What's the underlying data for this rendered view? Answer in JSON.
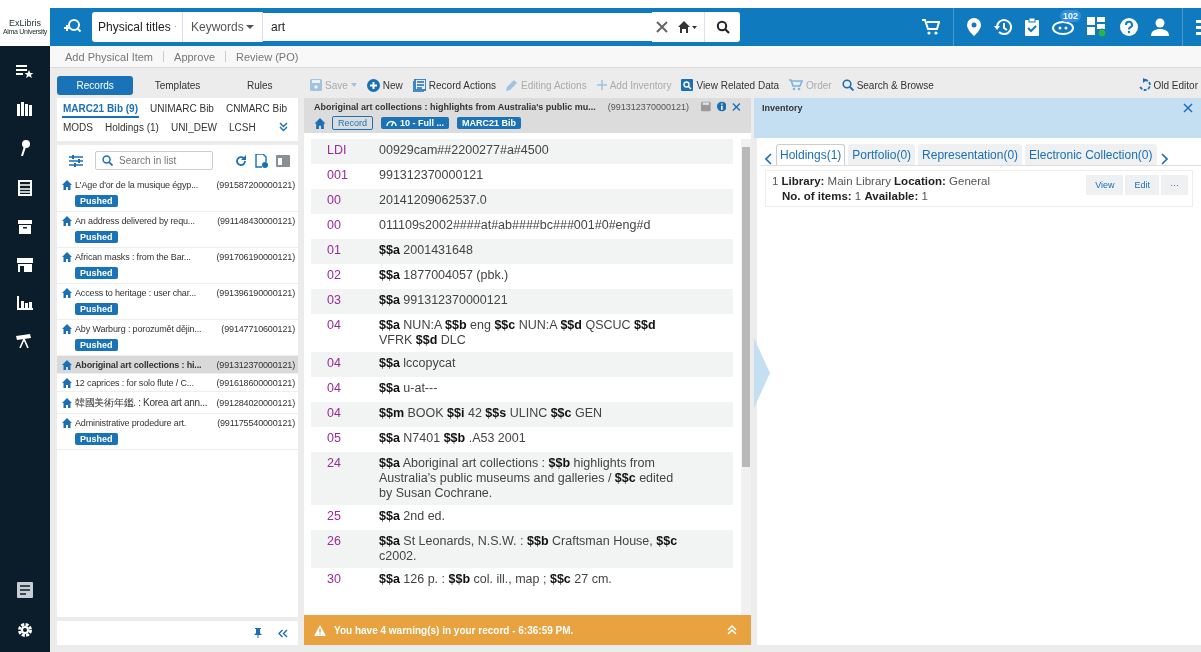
{
  "header": {
    "logo": "ExLibris",
    "logo_sub": "Alma University",
    "scope": "Physical titles",
    "search_field": "Keywords",
    "query": "art",
    "badge": "102"
  },
  "quick_links": [
    "Add Physical Item",
    "Approve",
    "Review (PO)"
  ],
  "panel_tabs": [
    {
      "label": "Records",
      "selected": true
    },
    {
      "label": "Templates",
      "selected": false
    },
    {
      "label": "Rules",
      "selected": false
    }
  ],
  "actions": [
    {
      "kind": "save",
      "label": "Save",
      "disabled": true
    },
    {
      "kind": "new",
      "label": "New",
      "disabled": false
    },
    {
      "kind": "record",
      "label": "Record Actions",
      "disabled": false
    },
    {
      "kind": "edit",
      "label": "Editing Actions",
      "disabled": true
    },
    {
      "kind": "add",
      "label": "Add Inventory",
      "disabled": true
    },
    {
      "kind": "view",
      "label": "View Related Data",
      "disabled": false
    },
    {
      "kind": "order",
      "label": "Order",
      "disabled": true
    },
    {
      "kind": "search",
      "label": "Search & Browse",
      "disabled": false
    }
  ],
  "old_editor": "Old Editor",
  "record_types": [
    {
      "label": "MARC21 Bib (9)",
      "selected": true
    },
    {
      "label": "UNIMARC Bib",
      "selected": false
    },
    {
      "label": "CNMARC Bib",
      "selected": false
    },
    {
      "label": "MODS",
      "selected": false
    },
    {
      "label": "Holdings (1)",
      "selected": false
    },
    {
      "label": "UNI_DEW",
      "selected": false
    },
    {
      "label": "LCSH",
      "selected": false
    }
  ],
  "list_search": {
    "placeholder": "Search in list"
  },
  "records": [
    {
      "title": "L'Age d'or de la musique égyp...",
      "id": "(991587200000121)",
      "pushed": true,
      "pushed_label": "Pushed",
      "selected": false
    },
    {
      "title": "An address delivered by requ...",
      "id": "(991148430000121)",
      "pushed": true,
      "pushed_label": "Pushed",
      "selected": false
    },
    {
      "title": "African masks : from the Bar...",
      "id": "(991706190000121)",
      "pushed": true,
      "pushed_label": "Pushed",
      "selected": false
    },
    {
      "title": "Access to heritage : user char...",
      "id": "(991396190000121)",
      "pushed": true,
      "pushed_label": "Pushed",
      "selected": false
    },
    {
      "title": "Aby Warburg : porozumět dějin...",
      "id": "(99147710600121)",
      "pushed": true,
      "pushed_label": "Pushed",
      "selected": false
    },
    {
      "title": "Aboriginal art collections : hi...",
      "id": "(991312370000121)",
      "pushed": false,
      "selected": true
    },
    {
      "title": "12 caprices : for solo flute / C...",
      "id": "(991618600000121)",
      "pushed": false,
      "selected": false
    },
    {
      "title": "韓國美術年鑑. : Korea art ann...",
      "id": "(991284020000121)",
      "pushed": false,
      "selected": false
    },
    {
      "title": "Administrative prodedure art.",
      "id": "(991175540000121)",
      "pushed": true,
      "pushed_label": "Pushed",
      "selected": false
    }
  ],
  "record_header": {
    "title": "Aboriginal art collections : highlights from Australia's public mu...",
    "id": "(991312370000121)",
    "tags": [
      {
        "kind": "outline",
        "label": "Record"
      },
      {
        "kind": "level",
        "label": "10 - Full ..."
      },
      {
        "kind": "filled",
        "label": "MARC21 Bib"
      }
    ]
  },
  "fields": [
    {
      "tag": "LDI",
      "value": "00929cam##2200277#a#4500"
    },
    {
      "tag": "001",
      "value": "991312370000121"
    },
    {
      "tag": "00",
      "value": "20141209062537.0"
    },
    {
      "tag": "00",
      "value": "011109s2002####at#ab####bc###001#0#eng#d"
    },
    {
      "tag": "01",
      "value": "**$$a** 2001431648"
    },
    {
      "tag": "02",
      "value": "**$$a** 1877004057 (pbk.)"
    },
    {
      "tag": "03",
      "value": "**$$a** 991312370000121"
    },
    {
      "tag": "04",
      "value": "**$$a** NUN:A **$$b** eng **$$c** NUN:A **$$d** QSCUC **$$d** VFRK **$$d** DLC"
    },
    {
      "tag": "04",
      "value": "**$$a** lccopycat"
    },
    {
      "tag": "04",
      "value": "**$$a** u-at---"
    },
    {
      "tag": "04",
      "value": "**$$m** BOOK **$$i** 42 **$$s** ULINC **$$c** GEN"
    },
    {
      "tag": "05",
      "value": "**$$a** N7401 **$$b** .A53 2001"
    },
    {
      "tag": "24",
      "value": "**$$a** Aboriginal art collections : **$$b** highlights from Australia's public museums and galleries / **$$c** edited by Susan Cochrane."
    },
    {
      "tag": "25",
      "value": "**$$a** 2nd ed."
    },
    {
      "tag": "26",
      "value": "**$$a** St Leonards, N.S.W. : **$$b** Craftsman House, **$$c** c2002."
    },
    {
      "tag": "30",
      "value": "**$$a** 126 p. : **$$b** col. ill., map ; **$$c** 27 cm."
    }
  ],
  "warning": "You have 4 warning(s) in your record - 6:36:59 PM.",
  "inventory": {
    "title": "Inventory",
    "tabs": [
      {
        "label": "Holdings(1)",
        "selected": true
      },
      {
        "label": "Portfolio(0)",
        "selected": false
      },
      {
        "label": "Representation(0)",
        "selected": false
      },
      {
        "label": "Electronic Collection(0)",
        "selected": false
      }
    ],
    "line1": "1 **Library:** Main Library **Location:** General",
    "line2": "**No. of items:** 1 **Available:** 1",
    "buttons": [
      "View",
      "Edit",
      "···"
    ]
  }
}
